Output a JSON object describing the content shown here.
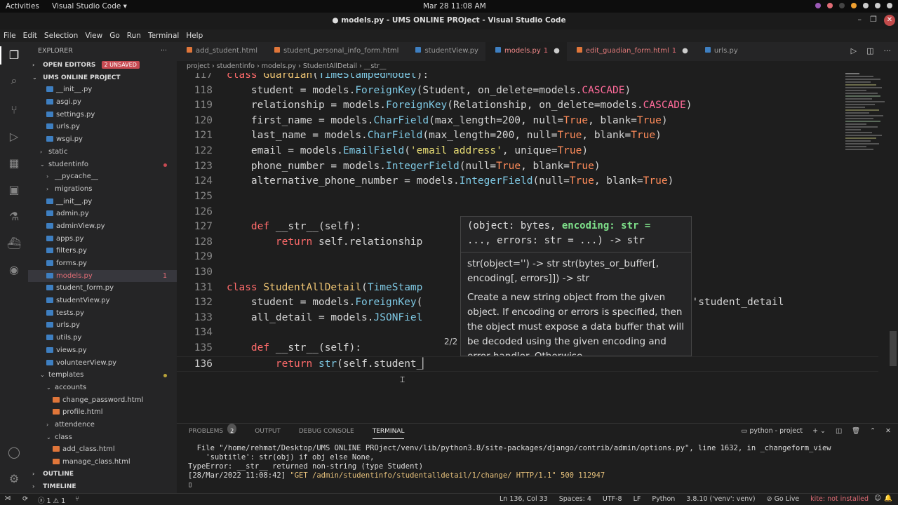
{
  "gnome": {
    "activities": "Activities",
    "app": "Visual Studio Code ▾",
    "clock": "Mar 28  11:08 AM"
  },
  "window": {
    "title": "● models.py - UMS ONLINE PROject - Visual Studio Code"
  },
  "menu": [
    "File",
    "Edit",
    "Selection",
    "View",
    "Go",
    "Run",
    "Terminal",
    "Help"
  ],
  "sidebar": {
    "title": "EXPLORER",
    "open_editors": "OPEN EDITORS",
    "unsaved": "2 UNSAVED",
    "project": "UMS ONLINE PROJECT",
    "items": [
      {
        "label": "__init__.py",
        "indent": 2,
        "type": "py"
      },
      {
        "label": "asgi.py",
        "indent": 2,
        "type": "py"
      },
      {
        "label": "settings.py",
        "indent": 2,
        "type": "py"
      },
      {
        "label": "urls.py",
        "indent": 2,
        "type": "py"
      },
      {
        "label": "wsgi.py",
        "indent": 2,
        "type": "py"
      },
      {
        "label": "static",
        "indent": 1,
        "type": "folder",
        "chev": "›"
      },
      {
        "label": "studentinfo",
        "indent": 1,
        "type": "folder-open",
        "chev": "⌄",
        "dot": "#c74a52"
      },
      {
        "label": "__pycache__",
        "indent": 2,
        "type": "folder",
        "chev": "›"
      },
      {
        "label": "migrations",
        "indent": 2,
        "type": "folder",
        "chev": "›"
      },
      {
        "label": "__init__.py",
        "indent": 2,
        "type": "py"
      },
      {
        "label": "admin.py",
        "indent": 2,
        "type": "py"
      },
      {
        "label": "adminView.py",
        "indent": 2,
        "type": "py"
      },
      {
        "label": "apps.py",
        "indent": 2,
        "type": "py"
      },
      {
        "label": "filters.py",
        "indent": 2,
        "type": "py"
      },
      {
        "label": "forms.py",
        "indent": 2,
        "type": "py"
      },
      {
        "label": "models.py",
        "indent": 2,
        "type": "py",
        "badge": "1",
        "selected": true
      },
      {
        "label": "student_form.py",
        "indent": 2,
        "type": "py"
      },
      {
        "label": "studentView.py",
        "indent": 2,
        "type": "py"
      },
      {
        "label": "tests.py",
        "indent": 2,
        "type": "py"
      },
      {
        "label": "urls.py",
        "indent": 2,
        "type": "py"
      },
      {
        "label": "utils.py",
        "indent": 2,
        "type": "py"
      },
      {
        "label": "views.py",
        "indent": 2,
        "type": "py"
      },
      {
        "label": "volunteerView.py",
        "indent": 2,
        "type": "py"
      },
      {
        "label": "templates",
        "indent": 1,
        "type": "folder-open",
        "chev": "⌄",
        "dot": "#b8a23a"
      },
      {
        "label": "accounts",
        "indent": 2,
        "type": "folder-open",
        "chev": "⌄"
      },
      {
        "label": "change_password.html",
        "indent": 3,
        "type": "html"
      },
      {
        "label": "profile.html",
        "indent": 3,
        "type": "html"
      },
      {
        "label": "attendence",
        "indent": 2,
        "type": "folder",
        "chev": "›"
      },
      {
        "label": "class",
        "indent": 2,
        "type": "folder-open",
        "chev": "⌄"
      },
      {
        "label": "add_class.html",
        "indent": 3,
        "type": "html"
      },
      {
        "label": "manage_class.html",
        "indent": 3,
        "type": "html"
      }
    ],
    "outline": "OUTLINE",
    "timeline": "TIMELINE"
  },
  "tabs": [
    {
      "label": "add_student.html",
      "type": "html"
    },
    {
      "label": "student_personal_info_form.html",
      "type": "html"
    },
    {
      "label": "studentView.py",
      "type": "py"
    },
    {
      "label": "models.py",
      "type": "py",
      "active": true,
      "count": "1",
      "modified": "●"
    },
    {
      "label": "edit_guadian_form.html",
      "type": "html",
      "count": "1",
      "modified": "●"
    },
    {
      "label": "urls.py",
      "type": "py"
    }
  ],
  "breadcrumb": "project  ›  studentinfo  ›  models.py  ›  StudentAllDetail  ›  __str__",
  "code": {
    "ln117": "117",
    "l117": "class Guardian(TimeStampedModel):",
    "ln118": "118",
    "ln119": "119",
    "ln120": "120",
    "ln121": "121",
    "ln122": "122",
    "ln123": "123",
    "ln124": "124",
    "ln125": "125",
    "ln126": "126",
    "ln127": "127",
    "ln128": "128",
    "ln129": "129",
    "ln130": "130",
    "ln131": "131",
    "ln132": "132",
    "ln133": "133",
    "ln134": "134",
    "ln135": "135",
    "ln136": "136"
  },
  "hover": {
    "signature_a": "(object: bytes, ",
    "signature_hl": "encoding: str =",
    "signature_b": "..., errors: str = ...) -> str",
    "doc1": "str(object='') -> str str(bytes_or_buffer[, encoding[, errors]]) -> str",
    "doc2": "Create a new string object from the given object. If encoding or errors is specified, then the object must expose a data buffer that will be decoded using the given encoding and error handler. Otherwise",
    "pager": "2/2",
    "tail132": "ed_name='student_detail"
  },
  "panel": {
    "tabs": [
      "PROBLEMS",
      "OUTPUT",
      "DEBUG CONSOLE",
      "TERMINAL"
    ],
    "problems_count": "2",
    "terminal_name": "python - project",
    "lines": [
      "  File \"/home/rehmat/Desktop/UMS ONLINE PROject/venv/lib/python3.8/site-packages/django/contrib/admin/options.py\", line 1632, in _changeform_view",
      "    'subtitle': str(obj) if obj else None,",
      "TypeError: __str__ returned non-string (type Student)"
    ],
    "last_pre": "[28/Mar/2022 11:08:42] ",
    "last_get": "\"GET /admin/studentinfo/studentalldetail/1/change/ HTTP/1.1\" 500 112947",
    "prompt": "▯"
  },
  "status": {
    "errors": "ⓧ 1 ⚠ 1",
    "position": "Ln 136, Col 33",
    "spaces": "Spaces: 4",
    "encoding": "UTF-8",
    "eol": "LF",
    "lang": "Python",
    "interp": "3.8.10 ('venv': venv)",
    "golive": "⊘ Go Live",
    "kite": "kite: not installed"
  }
}
